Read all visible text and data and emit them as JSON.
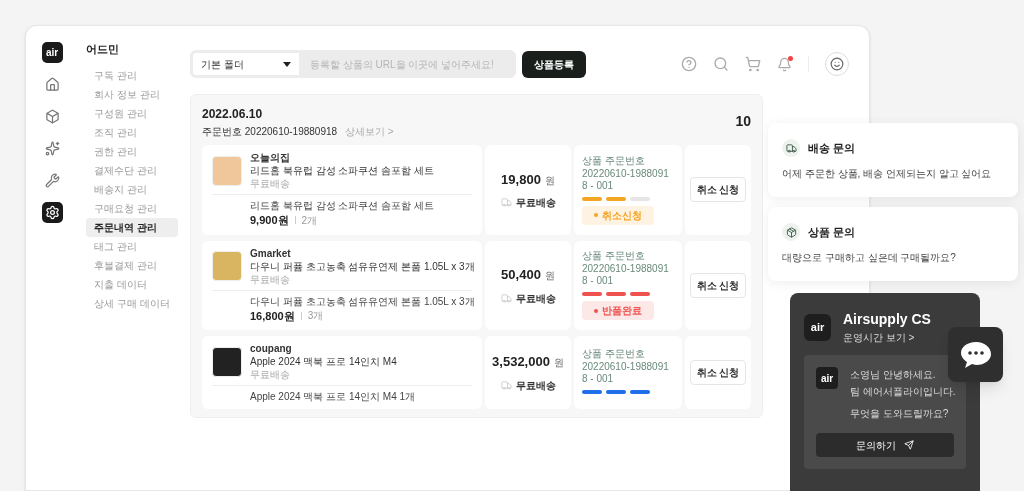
{
  "sidebar": {
    "logo": "air",
    "rail": [
      {
        "kind": "home",
        "selected": false
      },
      {
        "kind": "box",
        "selected": false
      },
      {
        "kind": "sparkle",
        "selected": false
      },
      {
        "kind": "tools",
        "selected": false
      },
      {
        "kind": "settings",
        "selected": true
      }
    ],
    "title": "어드민",
    "items": [
      {
        "label": "구독 관리",
        "selected": false
      },
      {
        "label": "회사 정보 관리",
        "selected": false
      },
      {
        "label": "구성원 관리",
        "selected": false
      },
      {
        "label": "조직 관리",
        "selected": false
      },
      {
        "label": "권한 관리",
        "selected": false
      },
      {
        "label": "결제수단 관리",
        "selected": false
      },
      {
        "label": "배송지 관리",
        "selected": false
      },
      {
        "label": "구매요청 관리",
        "selected": false
      },
      {
        "label": "주문내역 관리",
        "selected": true
      },
      {
        "label": "태그 관리",
        "selected": false
      },
      {
        "label": "후불결제 관리",
        "selected": false
      },
      {
        "label": "지출 데이터",
        "selected": false
      },
      {
        "label": "상세 구매 데이터",
        "selected": false
      }
    ]
  },
  "toolbar": {
    "folder": "기본 폴더",
    "url_placeholder": "등록할 상품의 URL을 이곳에 넣어주세요!",
    "register_button": "상품등록",
    "notification_dot": true
  },
  "order": {
    "date": "2022.06.10",
    "order_number": "주문번호 20220610-19880918",
    "detail_link": "상세보기 >",
    "total": "10",
    "items": [
      {
        "store": "오늘의집",
        "name": "리드홈 북유럽 감성 소파쿠션 솜포함 세트",
        "shipping_note": "무료배송",
        "line_name": "리드홈 북유럽 감성 소파쿠션 솜포함 세트",
        "unit_price": "9,900원",
        "qty": "2개",
        "total": "19,800",
        "currency": "원",
        "delivery": "무료배송",
        "sub_label": "상품 주문번호",
        "sub_number": "20220610-19880918 - 001",
        "color": "#f5a524",
        "steps": [
          {
            "on": true
          },
          {
            "on": true
          },
          {
            "on": false
          }
        ],
        "status": "취소신청",
        "cancel": "취소 신청"
      },
      {
        "store": "Gmarket",
        "name": "다우니 퍼퓸 초고농축 섬유유연제 본품 1.05L x 3개",
        "shipping_note": "무료배송",
        "line_name": "다우니 퍼퓸 초고농축 섬유유연제 본품 1.05L x 3개",
        "unit_price": "16,800원",
        "qty": "3개",
        "total": "50,400",
        "currency": "원",
        "delivery": "무료배송",
        "sub_label": "상품 주문번호",
        "sub_number": "20220610-19880918 - 001",
        "color": "#ef5350",
        "steps": [
          {
            "on": true
          },
          {
            "on": true
          },
          {
            "on": true
          }
        ],
        "status": "반품완료",
        "cancel": "취소 신청"
      },
      {
        "store": "coupang",
        "name": "Apple 2024 맥북 프로 14인치 M4",
        "shipping_note": "무료배송",
        "line_name": "Apple 2024 맥북 프로 14인치 M4 1개",
        "total": "3,532,000",
        "currency": "원",
        "delivery": "무료배송",
        "sub_label": "상품 주문번호",
        "sub_number": "20220610-19880918 - 001",
        "color": "#1e6fe8",
        "steps": [
          {
            "on": true
          },
          {
            "on": true
          },
          {
            "on": true
          }
        ],
        "cancel": "취소 신청"
      }
    ]
  },
  "support_cards": [
    {
      "kind": "truck",
      "title": "배송 문의",
      "text": "어제 주문한 상품, 배송 언제되는지 알고 싶어요"
    },
    {
      "kind": "box",
      "title": "상품 문의",
      "text": "대량으로 구매하고 싶은데 구매될까요?"
    }
  ],
  "cs_panel": {
    "logo": "air",
    "title": "Airsupply CS",
    "hours_link": "운영시간 보기 >",
    "avatar": "air",
    "messages": [
      "소영님 안녕하세요.",
      "팀 에어서플라이입니다.",
      "무엇을 도와드릴까요?"
    ],
    "button": "문의하기"
  }
}
